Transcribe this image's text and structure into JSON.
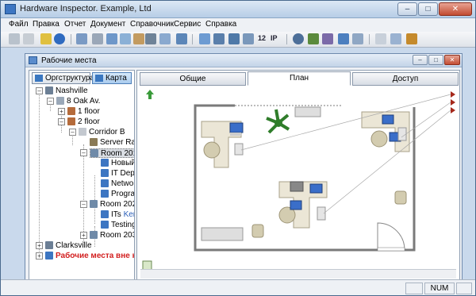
{
  "window": {
    "title": "Hardware Inspector. Example, Ltd"
  },
  "menu": [
    "Файл",
    "Правка",
    "Отчет",
    "Документ",
    "Справочник",
    "Сервис",
    "Справка"
  ],
  "toolbar": {
    "counter_label": "12",
    "ip_label": "IP"
  },
  "child_window": {
    "title": "Рабочие места"
  },
  "left_tabs": {
    "org": "Оргструктура",
    "map": "Карта"
  },
  "tree": {
    "nashville": "Nashville",
    "oak": "8 Oak Av.",
    "floor1": "1 floor",
    "floor2": "2 floor",
    "corridor": "Corridor B",
    "server": "Server Rac",
    "room201": "Room 201",
    "new": "Новый",
    "it_dept": "IT Depa",
    "network": "Networ",
    "programs": "Progra",
    "room202": "Room 202",
    "its": "ITs",
    "its_user": "Ken",
    "testing": "Testing",
    "room203": "Room 203",
    "clarksville": "Clarksville",
    "outside": "Рабочие места вне кар"
  },
  "right_tabs": {
    "general": "Общие",
    "plan": "План",
    "access": "Доступ"
  },
  "status": {
    "num": "NUM"
  },
  "colors": {
    "accent": "#3d76c2",
    "alert": "#d21e1e",
    "wall": "#7a7a7a",
    "desk": "#ebe6d6",
    "chair": "#d3ccb0"
  }
}
